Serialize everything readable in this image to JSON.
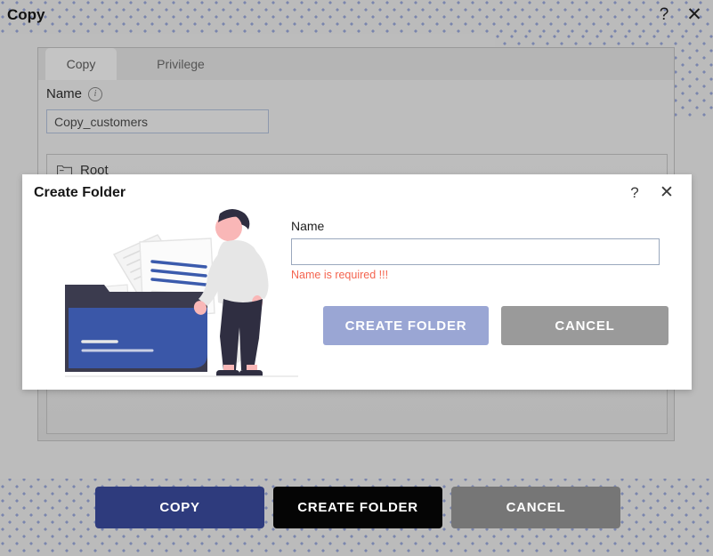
{
  "page": {
    "title": "Copy",
    "help_icon": "?",
    "close_icon": "✕"
  },
  "panel": {
    "tabs": [
      {
        "label": "Copy",
        "active": true
      },
      {
        "label": "Privilege",
        "active": false
      }
    ],
    "name_field": {
      "label": "Name",
      "info_icon": "i",
      "value": "Copy_customers",
      "placeholder": ""
    },
    "tree": {
      "items": [
        {
          "label": "Root",
          "icon": "folder-icon"
        }
      ]
    }
  },
  "footer": {
    "buttons": [
      {
        "label": "COPY",
        "color": "#2e3b7d"
      },
      {
        "label": "CREATE FOLDER",
        "color": "#050505"
      },
      {
        "label": "CANCEL",
        "color": "#767676"
      }
    ]
  },
  "modal": {
    "title": "Create Folder",
    "help_icon": "?",
    "close_icon": "✕",
    "illustration": "person-with-folder-illustration",
    "name_field": {
      "label": "Name",
      "value": "",
      "placeholder": "",
      "error": "Name is required !!!",
      "error_color": "#f4644f"
    },
    "buttons": [
      {
        "label": "CREATE FOLDER",
        "color": "#9aa6d4",
        "state": "disabled"
      },
      {
        "label": "CANCEL",
        "color": "#9a9a9a",
        "state": "enabled"
      }
    ]
  }
}
